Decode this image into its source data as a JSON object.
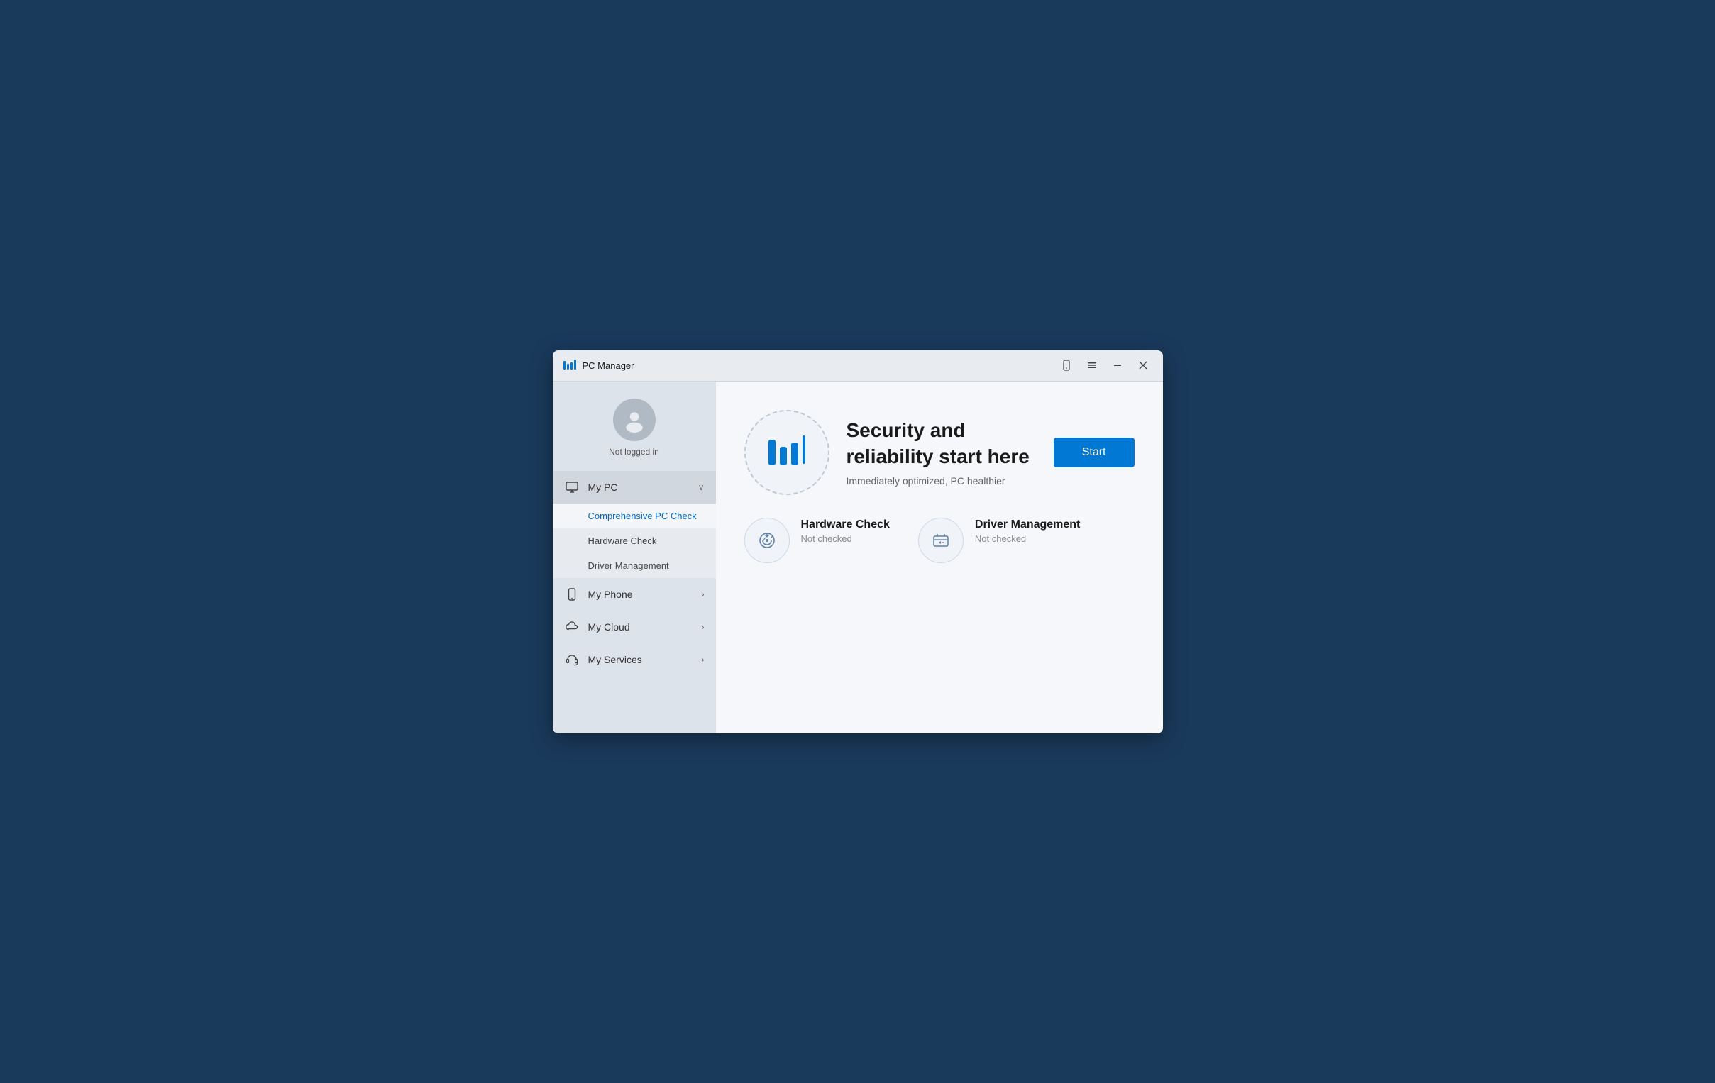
{
  "titleBar": {
    "appName": "PC Manager",
    "controls": {
      "phone": "📱",
      "menu": "☰",
      "minimize": "—",
      "close": "✕"
    }
  },
  "sidebar": {
    "userStatus": "Not logged in",
    "navItems": [
      {
        "id": "my-pc",
        "label": "My PC",
        "icon": "monitor-icon",
        "expanded": true,
        "chevron": "∨",
        "subItems": [
          {
            "id": "comprehensive-pc-check",
            "label": "Comprehensive PC Check",
            "active": true
          },
          {
            "id": "hardware-check",
            "label": "Hardware Check",
            "active": false
          },
          {
            "id": "driver-management",
            "label": "Driver Management",
            "active": false
          }
        ]
      },
      {
        "id": "my-phone",
        "label": "My Phone",
        "icon": "phone-icon",
        "expanded": false,
        "chevron": "›"
      },
      {
        "id": "my-cloud",
        "label": "My Cloud",
        "icon": "cloud-icon",
        "expanded": false,
        "chevron": "›"
      },
      {
        "id": "my-services",
        "label": "My Services",
        "icon": "headset-icon",
        "expanded": false,
        "chevron": "›"
      }
    ]
  },
  "content": {
    "hero": {
      "title": "Security and reliability start here",
      "subtitle": "Immediately optimized, PC healthier",
      "startButtonLabel": "Start"
    },
    "cards": [
      {
        "id": "hardware-check",
        "title": "Hardware Check",
        "status": "Not checked",
        "icon": "hardware-check-icon"
      },
      {
        "id": "driver-management",
        "title": "Driver Management",
        "status": "Not checked",
        "icon": "driver-management-icon"
      }
    ]
  }
}
